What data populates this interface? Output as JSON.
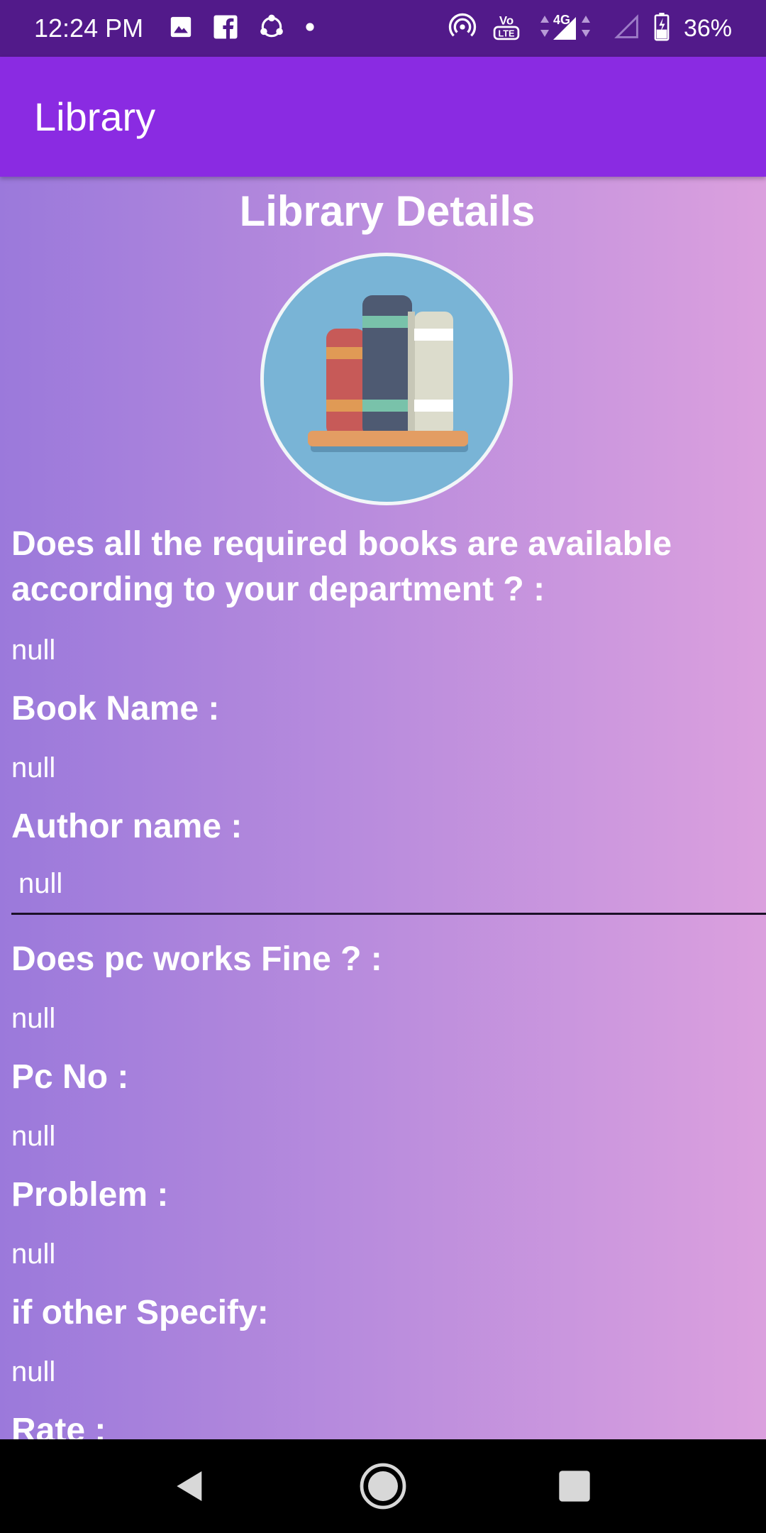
{
  "status_bar": {
    "time": "12:24 PM",
    "network": "4G",
    "battery": "36%",
    "volte": "Vo LTE"
  },
  "app_bar": {
    "title": "Library"
  },
  "page": {
    "heading": "Library Details",
    "fields": [
      {
        "label": "Does all the required books are available according to your department ? :",
        "value": "null"
      },
      {
        "label": "Book Name :",
        "value": "null"
      },
      {
        "label": "Author name :",
        "value": "null"
      },
      {
        "label": "Does pc works Fine ? :",
        "value": "null"
      },
      {
        "label": "Pc No :",
        "value": "null"
      },
      {
        "label": "Problem :",
        "value": "null"
      },
      {
        "label": "if other Specify:",
        "value": "null"
      },
      {
        "label": "Rate :",
        "value": ""
      }
    ]
  },
  "icons": {
    "status": [
      "image-icon",
      "facebook-icon",
      "share-icon",
      "dot-icon",
      "hotspot-icon",
      "volte-icon",
      "signal-4g-icon",
      "signal-empty-icon",
      "battery-icon"
    ],
    "nav": [
      "back-icon",
      "home-icon",
      "recents-icon"
    ],
    "logo": "books-icon"
  },
  "colors": {
    "status_bar": "#521a8a",
    "app_bar": "#8a2be2",
    "gradient_start": "#9b79db",
    "gradient_end": "#dba0de",
    "logo_bg": "#79b4d6"
  }
}
